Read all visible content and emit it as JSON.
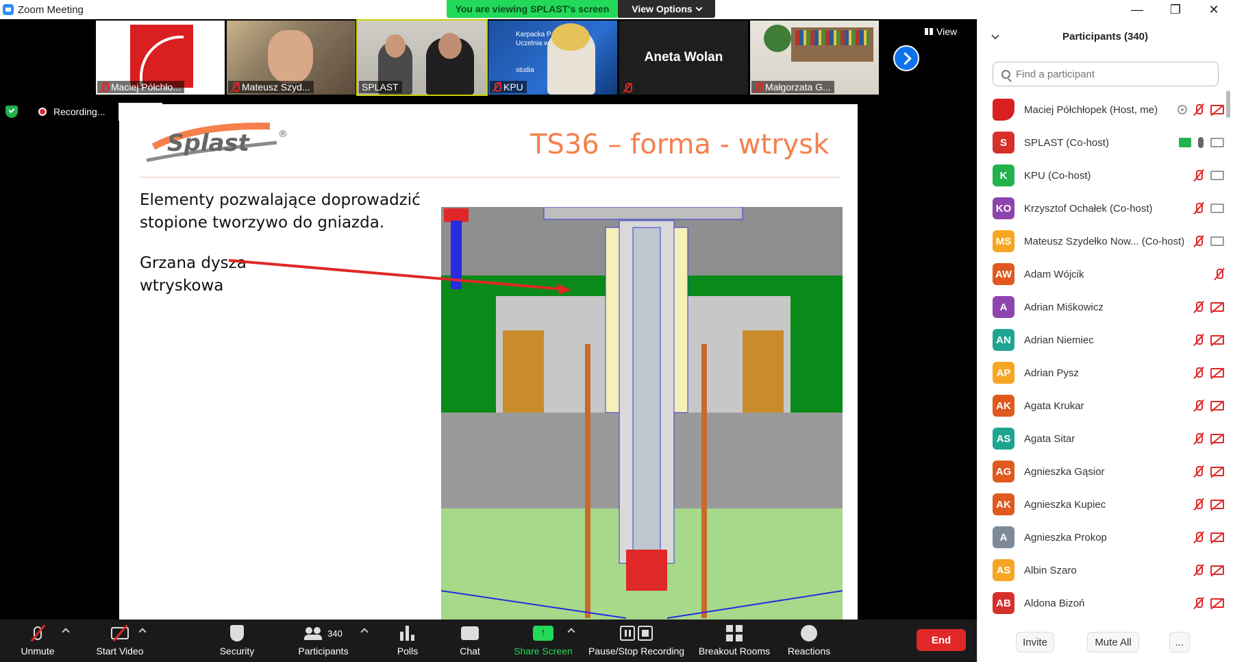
{
  "window": {
    "title": "Zoom Meeting"
  },
  "banner": {
    "viewing": "You are viewing SPLAST's screen",
    "view_options": "View Options"
  },
  "thumbnails": [
    {
      "name": "Maciej Półchło..."
    },
    {
      "name": "Mateusz Szyd..."
    },
    {
      "name": "SPLAST"
    },
    {
      "name": "KPU",
      "video_text": "Karpacka P...\nUczelnia w...\nstudia"
    },
    {
      "name": "Aneta Wolan"
    },
    {
      "name": "Małgorzata G..."
    }
  ],
  "view_button": "View",
  "recording": {
    "label": "Recording..."
  },
  "slide": {
    "title": "TS36 – forma - wtrysk",
    "text1_line1": "Elementy pozwalające doprowadzić",
    "text1_line2": "stopione tworzywo do gniazda.",
    "text2_line1": "Grzana dysza",
    "text2_line2": "wtryskowa",
    "logo_text": "Splast",
    "registered": "®"
  },
  "toolbar": {
    "unmute": "Unmute",
    "start_video": "Start Video",
    "security": "Security",
    "participants": "Participants",
    "participants_count": "340",
    "polls": "Polls",
    "chat": "Chat",
    "share_screen": "Share Screen",
    "pause_stop": "Pause/Stop Recording",
    "breakout": "Breakout Rooms",
    "reactions": "Reactions",
    "end": "End"
  },
  "panel": {
    "header": "Participants (340)",
    "search_placeholder": "Find a participant",
    "participants": [
      {
        "initials": "",
        "name": "Maciej Półchłopek (Host, me)",
        "color": "#d91f1f"
      },
      {
        "initials": "S",
        "name": "SPLAST (Co-host)",
        "color": "#d6302b"
      },
      {
        "initials": "K",
        "name": "KPU (Co-host)",
        "color": "#23b14d"
      },
      {
        "initials": "KO",
        "name": "Krzysztof Ochałek (Co-host)",
        "color": "#8e44ad"
      },
      {
        "initials": "MS",
        "name": "Mateusz Szydełko Now... (Co-host)",
        "color": "#f5a623"
      },
      {
        "initials": "AW",
        "name": "Adam Wójcik",
        "color": "#e0591e"
      },
      {
        "initials": "A",
        "name": "Adrian Miśkowicz",
        "color": "#8e44ad"
      },
      {
        "initials": "AN",
        "name": "Adrian Niemiec",
        "color": "#1fa58f"
      },
      {
        "initials": "AP",
        "name": "Adrian Pysz",
        "color": "#f5a623"
      },
      {
        "initials": "AK",
        "name": "Agata Krukar",
        "color": "#e0591e"
      },
      {
        "initials": "AS",
        "name": "Agata Sitar",
        "color": "#1fa58f"
      },
      {
        "initials": "AG",
        "name": "Agnieszka Gąsior",
        "color": "#e0591e"
      },
      {
        "initials": "AK",
        "name": "Agnieszka Kupiec",
        "color": "#e0591e"
      },
      {
        "initials": "A",
        "name": "Agnieszka Prokop",
        "color": "#7d8b99"
      },
      {
        "initials": "AS",
        "name": "Albin Szaro",
        "color": "#f5a623"
      },
      {
        "initials": "AB",
        "name": "Aldona Bizoń",
        "color": "#d6302b"
      }
    ],
    "invite": "Invite",
    "mute_all": "Mute All",
    "more": "..."
  }
}
